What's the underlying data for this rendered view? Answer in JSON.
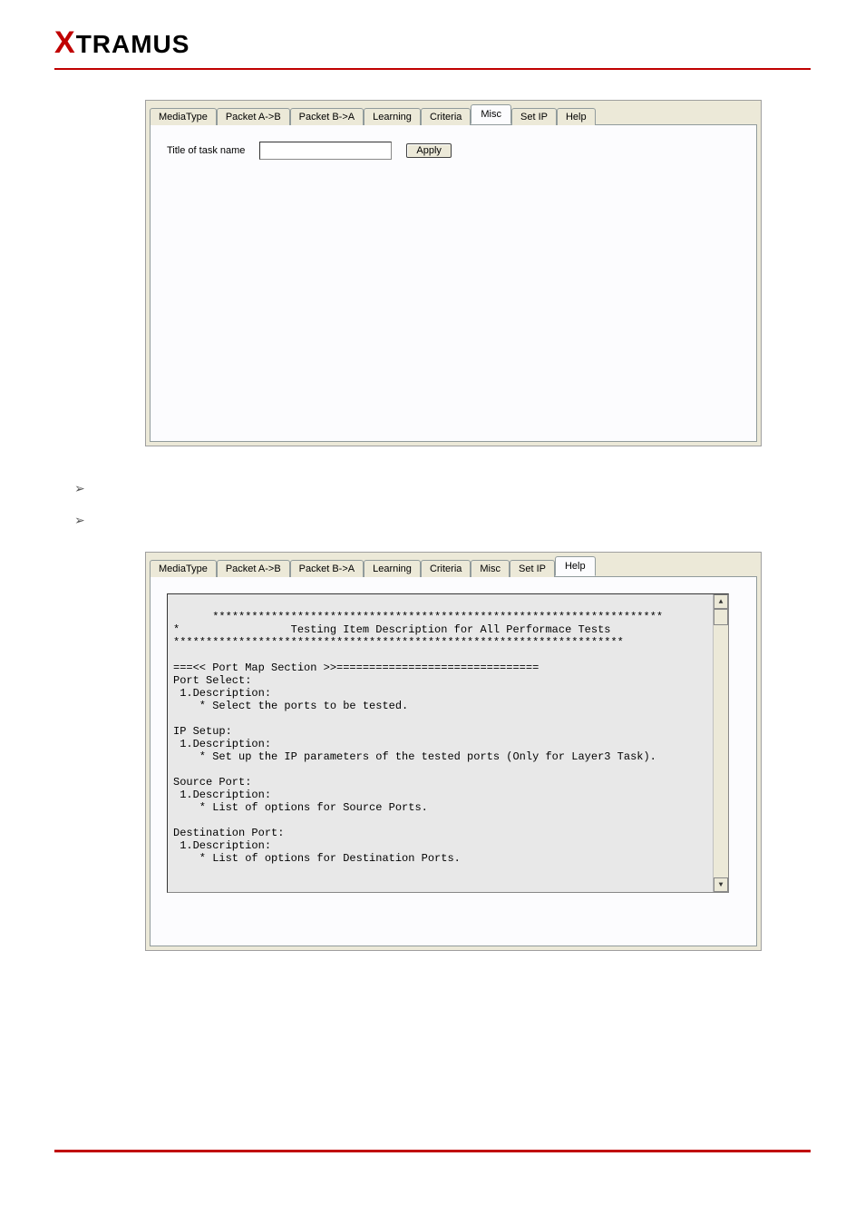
{
  "logo": {
    "prefix": "X",
    "rest": "TRAMUS"
  },
  "panel1": {
    "tabs": [
      "MediaType",
      "Packet A->B",
      "Packet B->A",
      "Learning",
      "Criteria",
      "Misc",
      "Set IP",
      "Help"
    ],
    "active_tab": "Misc",
    "title_label": "Title of task name",
    "title_value": "",
    "apply_label": "Apply"
  },
  "panel2": {
    "tabs": [
      "MediaType",
      "Packet A->B",
      "Packet B->A",
      "Learning",
      "Criteria",
      "Misc",
      "Set IP",
      "Help"
    ],
    "active_tab": "Help",
    "help_text": "*********************************************************************\n*                 Testing Item Description for All Performace Tests                 *\n*********************************************************************\n\n===<< Port Map Section >>===============================\nPort Select:\n 1.Description:\n    * Select the ports to be tested.\n\nIP Setup:\n 1.Description:\n    * Set up the IP parameters of the tested ports (Only for Layer3 Task).\n\nSource Port:\n 1.Description:\n    * List of options for Source Ports.\n\nDestination Port:\n 1.Description:\n    * List of options for Destination Ports."
  },
  "bullets": [
    "",
    ""
  ]
}
